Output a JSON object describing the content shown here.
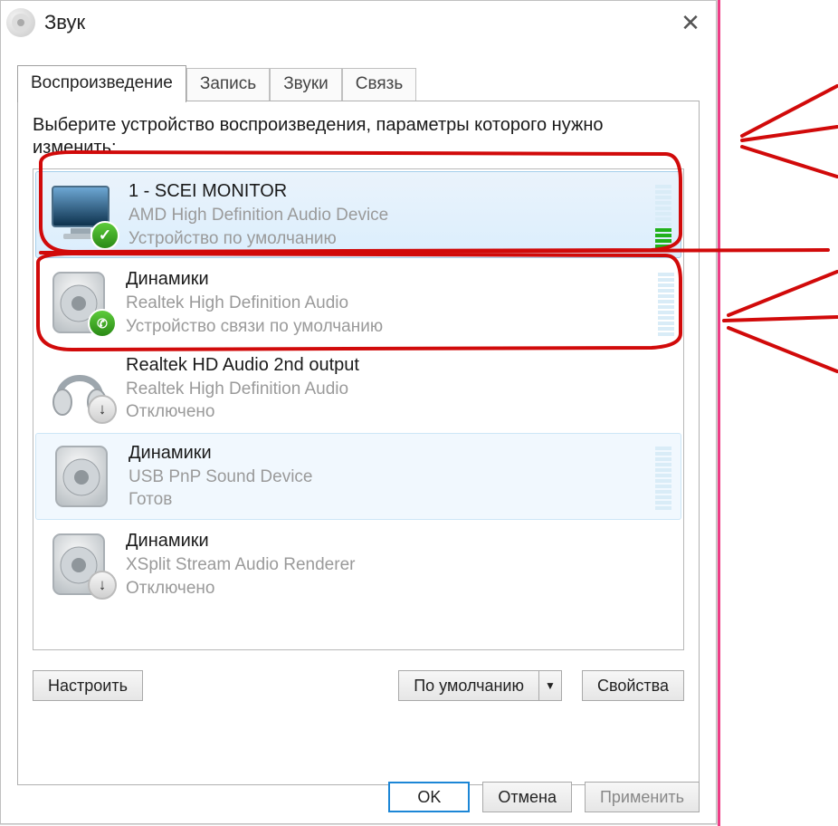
{
  "window": {
    "title": "Звук",
    "close_glyph": "✕"
  },
  "tabs": {
    "playback": "Воспроизведение",
    "recording": "Запись",
    "sounds": "Звуки",
    "communications": "Связь"
  },
  "instructions": "Выберите устройство воспроизведения, параметры которого нужно изменить:",
  "devices": [
    {
      "title": "1 - SCEI MONITOR",
      "subtitle": "AMD High Definition Audio Device",
      "status": "Устройство по умолчанию",
      "icon": "monitor",
      "badge": "check",
      "selected": true,
      "vu_active_segments": 4,
      "vu_visible": true
    },
    {
      "title": "Динамики",
      "subtitle": "Realtek High Definition Audio",
      "status": "Устройство связи по умолчанию",
      "icon": "speaker",
      "badge": "phone",
      "selected": false,
      "vu_active_segments": 0,
      "vu_visible": true
    },
    {
      "title": "Realtek HD Audio 2nd output",
      "subtitle": "Realtek High Definition Audio",
      "status": "Отключено",
      "icon": "headphones",
      "badge": "down",
      "selected": false,
      "vu_active_segments": 0,
      "vu_visible": false
    },
    {
      "title": "Динамики",
      "subtitle": "USB PnP Sound Device",
      "status": "Готов",
      "icon": "speaker",
      "badge": "",
      "selected": "light",
      "vu_active_segments": 0,
      "vu_visible": true
    },
    {
      "title": "Динамики",
      "subtitle": "XSplit Stream Audio Renderer",
      "status": "Отключено",
      "icon": "speaker",
      "badge": "down",
      "selected": false,
      "vu_active_segments": 0,
      "vu_visible": false
    }
  ],
  "buttons": {
    "configure": "Настроить",
    "default": "По умолчанию",
    "properties": "Свойства",
    "ok": "OK",
    "cancel": "Отмена",
    "apply": "Применить"
  }
}
